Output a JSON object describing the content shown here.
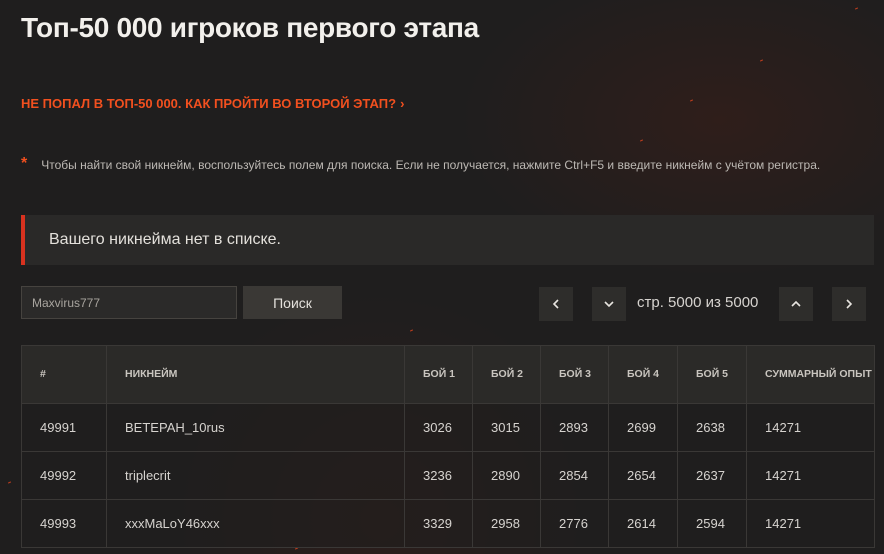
{
  "header": {
    "title": "Топ-50 000 игроков первого этапа",
    "promo_link": "НЕ ПОПАЛ В ТОП-50 000. КАК ПРОЙТИ ВО ВТОРОЙ ЭТАП?",
    "promo_chevron": "›"
  },
  "note": {
    "marker": "*",
    "text": "Чтобы найти свой никнейм, воспользуйтесь полем для поиска. Если не получается, нажмите Ctrl+F5 и введите никнейм с учётом регистра."
  },
  "alert": {
    "text": "Вашего никнейма нет в списке.",
    "accent_color": "#d8321f"
  },
  "search": {
    "value": "Maxvirus777",
    "button_label": "Поиск"
  },
  "pagination": {
    "status": "стр. 5000 из 5000",
    "prev_icon": "chevron-left-icon",
    "down_icon": "chevron-down-icon",
    "up_icon": "chevron-up-icon",
    "next_icon": "chevron-right-icon"
  },
  "table": {
    "columns": [
      "#",
      "НИКНЕЙМ",
      "БОЙ 1",
      "БОЙ 2",
      "БОЙ 3",
      "БОЙ 4",
      "БОЙ 5",
      "СУММАРНЫЙ ОПЫТ"
    ],
    "rows": [
      {
        "rank": "49991",
        "nickname": "ВЕТЕРАН_10rus",
        "b1": "3026",
        "b2": "3015",
        "b3": "2893",
        "b4": "2699",
        "b5": "2638",
        "total": "14271"
      },
      {
        "rank": "49992",
        "nickname": "triplecrit",
        "b1": "3236",
        "b2": "2890",
        "b3": "2854",
        "b4": "2654",
        "b5": "2637",
        "total": "14271"
      },
      {
        "rank": "49993",
        "nickname": "xxxMaLoY46xxx",
        "b1": "3329",
        "b2": "2958",
        "b3": "2776",
        "b4": "2614",
        "b5": "2594",
        "total": "14271"
      }
    ]
  },
  "colors": {
    "background": "#1f1e1e",
    "accent": "#f2501f"
  }
}
